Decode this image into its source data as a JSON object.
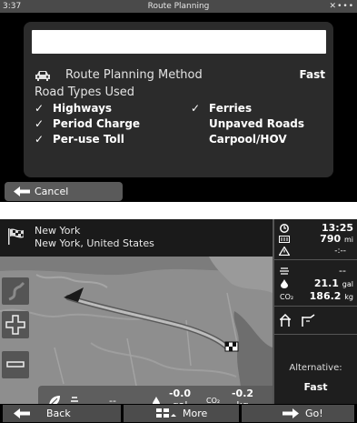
{
  "top_screen": {
    "status_bar": {
      "time": "3:37",
      "title": "Route Planning",
      "indicators": "✕•••"
    },
    "route_method": {
      "label": "Route Planning Method",
      "value": "Fast",
      "icon": "car-icon"
    },
    "road_types": {
      "heading": "Road Types Used",
      "items": [
        {
          "label": "Highways",
          "checked": true
        },
        {
          "label": "Period Charge",
          "checked": true
        },
        {
          "label": "Per-use Toll",
          "checked": true
        },
        {
          "label": "Ferries",
          "checked": true
        },
        {
          "label": "Unpaved Roads",
          "checked": false
        },
        {
          "label": "Carpool/HOV",
          "checked": false
        }
      ],
      "check_glyph": "✓"
    },
    "cancel_button": {
      "label": "Cancel",
      "icon": "arrow-left-icon"
    }
  },
  "bottom_screen": {
    "destination": {
      "city": "New York",
      "address": "New York, United States",
      "icon": "checkered-flag-icon"
    },
    "map_stats": {
      "distance": "--",
      "fuel_value": "-0.0",
      "fuel_unit": "gal",
      "co2_label": "CO₂",
      "co2_value": "-0.2",
      "co2_unit": "kg"
    },
    "summary": {
      "eta": "13:25",
      "distance_value": "790",
      "distance_unit": "mi",
      "warning_value": "-:--",
      "toll_value": "--",
      "fuel_value": "21.1",
      "fuel_unit": "gal",
      "co2_label": "CO₂",
      "co2_value": "186.2",
      "co2_unit": "kg"
    },
    "alternative": {
      "label": "Alternative:",
      "value": "Fast"
    },
    "buttons": {
      "back": "Back",
      "more": "More",
      "go": "Go!"
    }
  },
  "colors": {
    "panel": "#2b2b2b",
    "map": "#8c8c8c",
    "route": "#b4b4b4",
    "button": "#4c4c4c"
  }
}
